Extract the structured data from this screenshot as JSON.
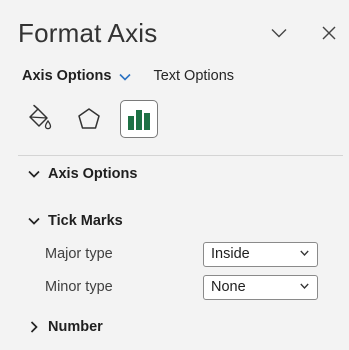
{
  "pane": {
    "title": "Format Axis",
    "dropdown_icon": "chevron-down-icon",
    "close_icon": "close-icon"
  },
  "options": {
    "axis_options_label": "Axis Options",
    "text_options_label": "Text Options",
    "accent_color": "#2b72c2"
  },
  "icon_tabs": [
    {
      "name": "fill-line",
      "icon": "paint-bucket-icon"
    },
    {
      "name": "effects",
      "icon": "pentagon-icon"
    },
    {
      "name": "axis-options",
      "icon": "bar-chart-icon",
      "selected": true,
      "color": "#1e7145"
    }
  ],
  "sections": {
    "axis_options": {
      "label": "Axis Options",
      "expanded": true
    },
    "tick_marks": {
      "label": "Tick Marks",
      "expanded": true,
      "major_label": "Major type",
      "major_value": "Inside",
      "minor_label": "Minor type",
      "minor_value": "None"
    },
    "number": {
      "label": "Number",
      "expanded": false
    }
  }
}
